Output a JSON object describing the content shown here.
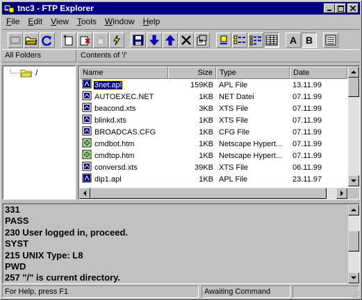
{
  "window": {
    "title": "tnc3 - FTP Explorer",
    "titlebar_color": "#000080"
  },
  "menu": [
    {
      "key": "F",
      "rest": "ile"
    },
    {
      "key": "E",
      "rest": "dit"
    },
    {
      "key": "V",
      "rest": "iew"
    },
    {
      "key": "T",
      "rest": "ools"
    },
    {
      "key": "W",
      "rest": "indow"
    },
    {
      "key": "H",
      "rest": "elp"
    }
  ],
  "toolbar": {
    "buttons": [
      {
        "name": "connect-icon",
        "state": "disabled"
      },
      {
        "name": "open-folder-icon",
        "state": "normal"
      },
      {
        "name": "refresh-icon",
        "state": "normal"
      },
      {
        "name": "new-folder-icon",
        "state": "normal"
      },
      {
        "name": "delete-icon",
        "state": "normal"
      },
      {
        "name": "stop-hand-icon",
        "state": "disabled"
      },
      {
        "name": "disconnect-icon",
        "state": "normal"
      },
      {
        "name": "save-icon",
        "state": "normal"
      },
      {
        "name": "download-icon",
        "state": "normal"
      },
      {
        "name": "upload-icon",
        "state": "normal"
      },
      {
        "name": "cancel-icon",
        "state": "normal"
      },
      {
        "name": "properties-icon",
        "state": "normal"
      },
      {
        "name": "large-icons-view-icon",
        "state": "normal"
      },
      {
        "name": "small-icons-view-icon",
        "state": "normal"
      },
      {
        "name": "list-view-icon",
        "state": "normal"
      },
      {
        "name": "details-view-icon",
        "state": "pressed"
      },
      {
        "name": "ascii-mode-icon",
        "state": "normal",
        "letter": "A"
      },
      {
        "name": "binary-mode-icon",
        "state": "pressed",
        "letter": "B"
      },
      {
        "name": "log-view-icon",
        "state": "normal"
      }
    ]
  },
  "panes": {
    "folders_header": "All Folders",
    "contents_header": "Contents of '/'"
  },
  "tree": {
    "root_label": "/"
  },
  "filelist": {
    "columns": [
      "Name",
      "Size",
      "Type",
      "Date"
    ],
    "rows": [
      {
        "name": "3net.apl",
        "size": "159KB",
        "type": "APL File",
        "date": "13.11.99",
        "icon": "apl-file-icon",
        "selected": true
      },
      {
        "name": "AUTOEXEC.NET",
        "size": "1KB",
        "type": "NET Datei",
        "date": "07.11.99",
        "icon": "generic-file-icon",
        "selected": false
      },
      {
        "name": "beacond.xts",
        "size": "3KB",
        "type": "XTS File",
        "date": "07.11.99",
        "icon": "generic-file-icon",
        "selected": false
      },
      {
        "name": "blinkd.xts",
        "size": "1KB",
        "type": "XTS File",
        "date": "07.11.99",
        "icon": "generic-file-icon",
        "selected": false
      },
      {
        "name": "BROADCAS.CFG",
        "size": "1KB",
        "type": "CFG File",
        "date": "07.11.99",
        "icon": "generic-file-icon",
        "selected": false
      },
      {
        "name": "cmdbot.htm",
        "size": "1KB",
        "type": "Netscape Hypert...",
        "date": "07.11.99",
        "icon": "html-file-icon",
        "selected": false
      },
      {
        "name": "cmdtop.htm",
        "size": "1KB",
        "type": "Netscape Hypert...",
        "date": "07.11.99",
        "icon": "html-file-icon",
        "selected": false
      },
      {
        "name": "conversd.xts",
        "size": "39KB",
        "type": "XTS File",
        "date": "06.11.99",
        "icon": "generic-file-icon",
        "selected": false
      },
      {
        "name": "dip1.apl",
        "size": "1KB",
        "type": "APL File",
        "date": "23.11.97",
        "icon": "apl-file-icon",
        "selected": false
      }
    ]
  },
  "log": {
    "lines": [
      "331",
      "PASS",
      "230 User logged in, proceed.",
      "SYST",
      "215 UNIX Type: L8",
      "PWD",
      "257 \"/\" is current directory."
    ]
  },
  "status": {
    "main": "For Help, press F1",
    "command": "Awaiting Command",
    "extra": ""
  }
}
